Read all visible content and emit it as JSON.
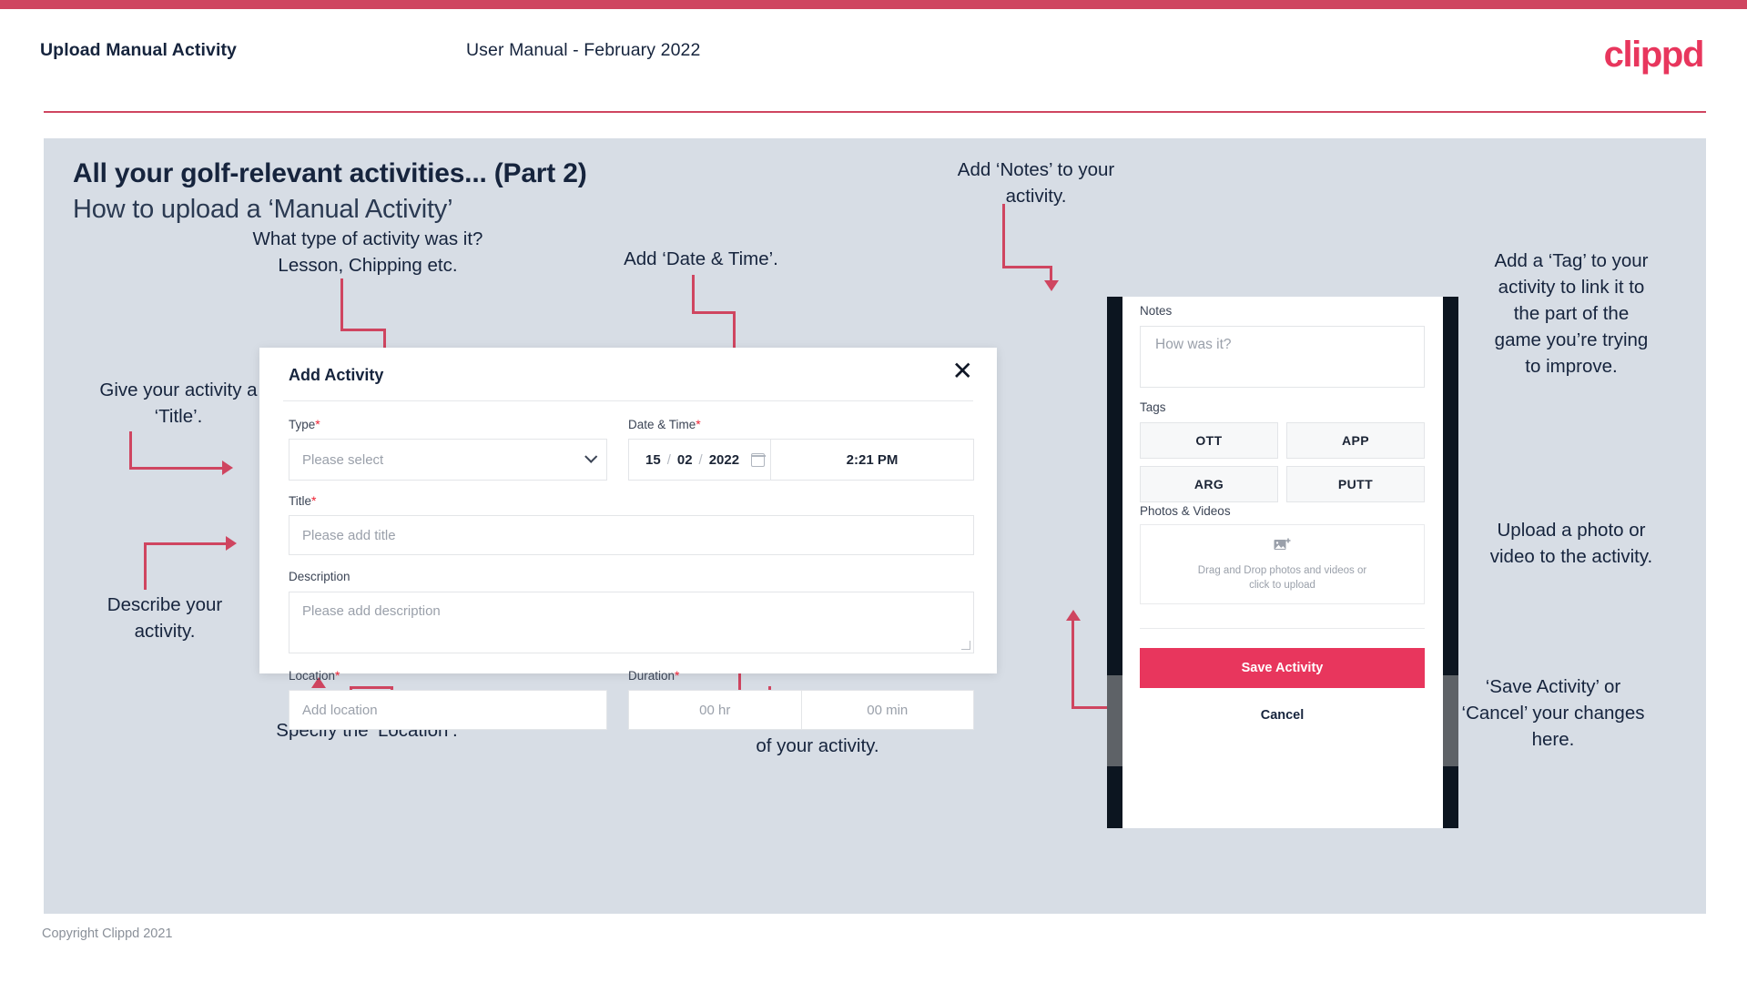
{
  "header": {
    "title": "Upload Manual Activity",
    "subtitle": "User Manual - February 2022",
    "logo": "clippd"
  },
  "slide": {
    "title": "All your golf-relevant activities... (Part 2)",
    "subtitle": "How to upload a ‘Manual Activity’"
  },
  "annotations": {
    "type": "What type of activity was it?\nLesson, Chipping etc.",
    "datetime": "Add ‘Date & Time’.",
    "title": "Give your activity a\n‘Title’.",
    "description": "Describe your\nactivity.",
    "location": "Specify the ‘Location’.",
    "duration": "Specify the ‘Duration’\nof your activity.",
    "notes": "Add ‘Notes’ to your\nactivity.",
    "tag": "Add a ‘Tag’ to your\nactivity to link it to\nthe part of the\ngame you’re trying\nto improve.",
    "photo": "Upload a photo or\nvideo to the activity.",
    "save": "‘Save Activity’ or\n‘Cancel’ your changes\nhere."
  },
  "dialog": {
    "title": "Add Activity",
    "close": "✕",
    "fields": {
      "type": {
        "label": "Type",
        "required": "*",
        "placeholder": "Please select"
      },
      "datetime": {
        "label": "Date & Time",
        "required": "*",
        "day": "15",
        "month": "02",
        "year": "2022",
        "sep": "/",
        "time": "2:21 PM"
      },
      "title": {
        "label": "Title",
        "required": "*",
        "placeholder": "Please add title"
      },
      "description": {
        "label": "Description",
        "required": "",
        "placeholder": "Please add description"
      },
      "location": {
        "label": "Location",
        "required": "*",
        "placeholder": "Add location"
      },
      "duration": {
        "label": "Duration",
        "required": "*",
        "hours": "00 hr",
        "minutes": "00 min"
      }
    }
  },
  "phone": {
    "notes_label": "Notes",
    "notes_placeholder": "How was it?",
    "tags_label": "Tags",
    "tags": [
      "OTT",
      "APP",
      "ARG",
      "PUTT"
    ],
    "photos_label": "Photos & Videos",
    "dropzone_line1": "Drag and Drop photos and videos or",
    "dropzone_line2": "click to upload",
    "save_label": "Save Activity",
    "cancel_label": "Cancel"
  },
  "footer": {
    "copyright": "Copyright Clippd 2021"
  },
  "colors": {
    "accent": "#cf4560",
    "brand": "#e8365d",
    "canvas": "#d7dde5",
    "text_dark": "#16243d"
  }
}
